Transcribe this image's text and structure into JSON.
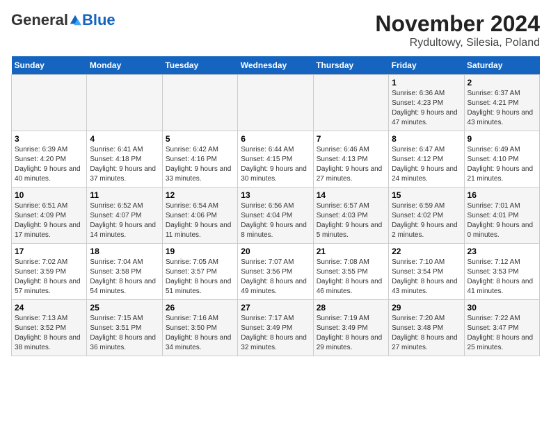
{
  "header": {
    "logo_general": "General",
    "logo_blue": "Blue",
    "title": "November 2024",
    "subtitle": "Rydultowy, Silesia, Poland"
  },
  "weekdays": [
    "Sunday",
    "Monday",
    "Tuesday",
    "Wednesday",
    "Thursday",
    "Friday",
    "Saturday"
  ],
  "weeks": [
    [
      {
        "day": "",
        "info": ""
      },
      {
        "day": "",
        "info": ""
      },
      {
        "day": "",
        "info": ""
      },
      {
        "day": "",
        "info": ""
      },
      {
        "day": "",
        "info": ""
      },
      {
        "day": "1",
        "info": "Sunrise: 6:36 AM\nSunset: 4:23 PM\nDaylight: 9 hours and 47 minutes."
      },
      {
        "day": "2",
        "info": "Sunrise: 6:37 AM\nSunset: 4:21 PM\nDaylight: 9 hours and 43 minutes."
      }
    ],
    [
      {
        "day": "3",
        "info": "Sunrise: 6:39 AM\nSunset: 4:20 PM\nDaylight: 9 hours and 40 minutes."
      },
      {
        "day": "4",
        "info": "Sunrise: 6:41 AM\nSunset: 4:18 PM\nDaylight: 9 hours and 37 minutes."
      },
      {
        "day": "5",
        "info": "Sunrise: 6:42 AM\nSunset: 4:16 PM\nDaylight: 9 hours and 33 minutes."
      },
      {
        "day": "6",
        "info": "Sunrise: 6:44 AM\nSunset: 4:15 PM\nDaylight: 9 hours and 30 minutes."
      },
      {
        "day": "7",
        "info": "Sunrise: 6:46 AM\nSunset: 4:13 PM\nDaylight: 9 hours and 27 minutes."
      },
      {
        "day": "8",
        "info": "Sunrise: 6:47 AM\nSunset: 4:12 PM\nDaylight: 9 hours and 24 minutes."
      },
      {
        "day": "9",
        "info": "Sunrise: 6:49 AM\nSunset: 4:10 PM\nDaylight: 9 hours and 21 minutes."
      }
    ],
    [
      {
        "day": "10",
        "info": "Sunrise: 6:51 AM\nSunset: 4:09 PM\nDaylight: 9 hours and 17 minutes."
      },
      {
        "day": "11",
        "info": "Sunrise: 6:52 AM\nSunset: 4:07 PM\nDaylight: 9 hours and 14 minutes."
      },
      {
        "day": "12",
        "info": "Sunrise: 6:54 AM\nSunset: 4:06 PM\nDaylight: 9 hours and 11 minutes."
      },
      {
        "day": "13",
        "info": "Sunrise: 6:56 AM\nSunset: 4:04 PM\nDaylight: 9 hours and 8 minutes."
      },
      {
        "day": "14",
        "info": "Sunrise: 6:57 AM\nSunset: 4:03 PM\nDaylight: 9 hours and 5 minutes."
      },
      {
        "day": "15",
        "info": "Sunrise: 6:59 AM\nSunset: 4:02 PM\nDaylight: 9 hours and 2 minutes."
      },
      {
        "day": "16",
        "info": "Sunrise: 7:01 AM\nSunset: 4:01 PM\nDaylight: 9 hours and 0 minutes."
      }
    ],
    [
      {
        "day": "17",
        "info": "Sunrise: 7:02 AM\nSunset: 3:59 PM\nDaylight: 8 hours and 57 minutes."
      },
      {
        "day": "18",
        "info": "Sunrise: 7:04 AM\nSunset: 3:58 PM\nDaylight: 8 hours and 54 minutes."
      },
      {
        "day": "19",
        "info": "Sunrise: 7:05 AM\nSunset: 3:57 PM\nDaylight: 8 hours and 51 minutes."
      },
      {
        "day": "20",
        "info": "Sunrise: 7:07 AM\nSunset: 3:56 PM\nDaylight: 8 hours and 49 minutes."
      },
      {
        "day": "21",
        "info": "Sunrise: 7:08 AM\nSunset: 3:55 PM\nDaylight: 8 hours and 46 minutes."
      },
      {
        "day": "22",
        "info": "Sunrise: 7:10 AM\nSunset: 3:54 PM\nDaylight: 8 hours and 43 minutes."
      },
      {
        "day": "23",
        "info": "Sunrise: 7:12 AM\nSunset: 3:53 PM\nDaylight: 8 hours and 41 minutes."
      }
    ],
    [
      {
        "day": "24",
        "info": "Sunrise: 7:13 AM\nSunset: 3:52 PM\nDaylight: 8 hours and 38 minutes."
      },
      {
        "day": "25",
        "info": "Sunrise: 7:15 AM\nSunset: 3:51 PM\nDaylight: 8 hours and 36 minutes."
      },
      {
        "day": "26",
        "info": "Sunrise: 7:16 AM\nSunset: 3:50 PM\nDaylight: 8 hours and 34 minutes."
      },
      {
        "day": "27",
        "info": "Sunrise: 7:17 AM\nSunset: 3:49 PM\nDaylight: 8 hours and 32 minutes."
      },
      {
        "day": "28",
        "info": "Sunrise: 7:19 AM\nSunset: 3:49 PM\nDaylight: 8 hours and 29 minutes."
      },
      {
        "day": "29",
        "info": "Sunrise: 7:20 AM\nSunset: 3:48 PM\nDaylight: 8 hours and 27 minutes."
      },
      {
        "day": "30",
        "info": "Sunrise: 7:22 AM\nSunset: 3:47 PM\nDaylight: 8 hours and 25 minutes."
      }
    ]
  ]
}
